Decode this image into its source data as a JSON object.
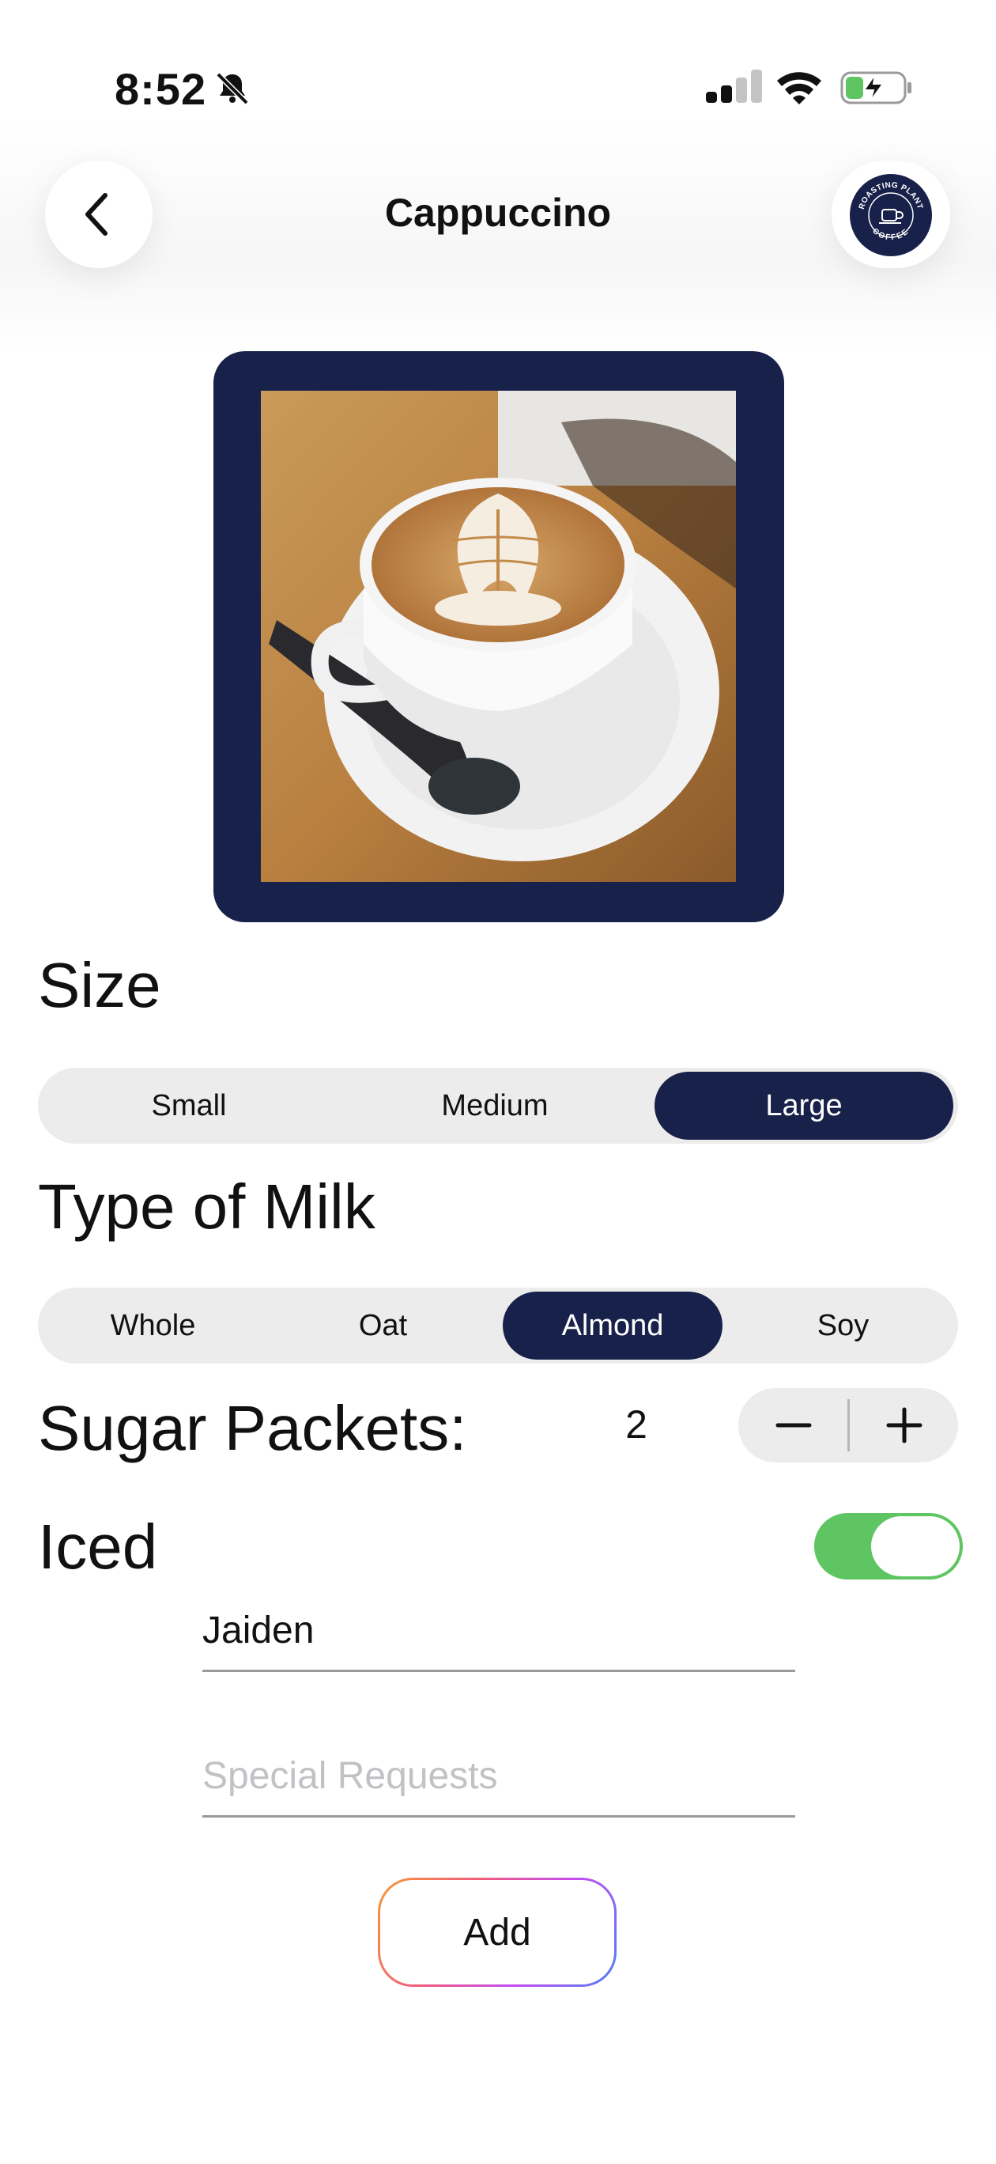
{
  "status_bar": {
    "time": "8:52"
  },
  "header": {
    "title": "Cappuccino",
    "logo_top": "ROASTING PLANT",
    "logo_bottom": "COFFEE"
  },
  "size": {
    "label": "Size",
    "options": [
      "Small",
      "Medium",
      "Large"
    ],
    "selected": "Large"
  },
  "milk": {
    "label": "Type of Milk",
    "options": [
      "Whole",
      "Oat",
      "Almond",
      "Soy"
    ],
    "selected": "Almond"
  },
  "sugar": {
    "label": "Sugar Packets:",
    "count": "2"
  },
  "iced": {
    "label": "Iced",
    "on": true
  },
  "form": {
    "name_value": "Jaiden",
    "requests_placeholder": "Special Requests",
    "add_label": "Add"
  },
  "colors": {
    "accent": "#18214a",
    "toggle_on": "#5fc562"
  }
}
